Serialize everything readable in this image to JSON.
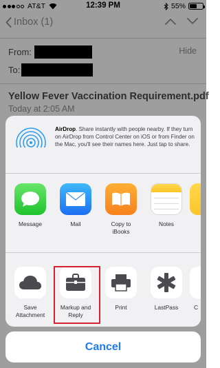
{
  "status_bar": {
    "carrier": "AT&T",
    "time": "12:39 PM",
    "battery_text": "55%",
    "battery_level": 0.55
  },
  "nav": {
    "back_label": "Inbox (1)"
  },
  "header": {
    "from_label": "From:",
    "to_label": "To:",
    "hide_label": "Hide"
  },
  "message": {
    "subject": "Yellow Fever Vaccination Requirement.pdf",
    "date": "Today at 2:05 AM"
  },
  "share_sheet": {
    "airdrop": {
      "title": "AirDrop",
      "description": ". Share instantly with people nearby. If they turn on AirDrop from Control Center on iOS or from Finder on the Mac, you'll see their names here. Just tap to share."
    },
    "apps": [
      {
        "label": "Message",
        "icon": "message-icon"
      },
      {
        "label": "Mail",
        "icon": "mail-icon"
      },
      {
        "label": "Copy to\niBooks",
        "icon": "ibooks-icon"
      },
      {
        "label": "Notes",
        "icon": "notes-icon"
      }
    ],
    "actions": [
      {
        "label": "Save\nAttachment",
        "icon": "cloud-icon"
      },
      {
        "label": "Markup and\nReply",
        "icon": "toolbox-icon"
      },
      {
        "label": "Print",
        "icon": "printer-icon"
      },
      {
        "label": "LastPass",
        "icon": "lastpass-icon"
      },
      {
        "label": "C",
        "icon": "partial-icon"
      }
    ],
    "cancel_label": "Cancel"
  },
  "colors": {
    "accent": "#1f7bf5",
    "highlight": "#d6202e"
  }
}
